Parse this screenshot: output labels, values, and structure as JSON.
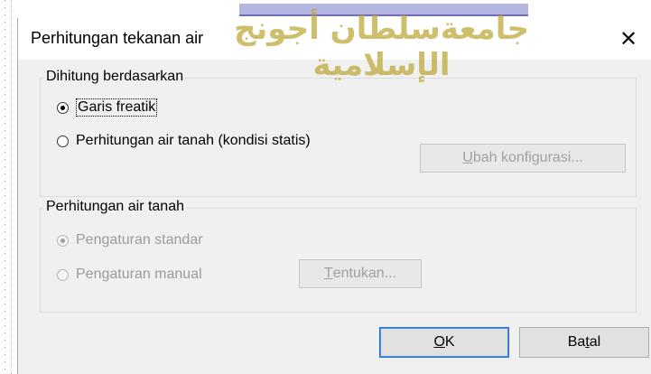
{
  "window": {
    "title": "Perhitungan tekanan air",
    "close_symbol": "✕"
  },
  "group_basis": {
    "legend": "Dihitung berdasarkan",
    "options": [
      {
        "label": "Garis freatik",
        "checked": true,
        "enabled": true
      },
      {
        "label": "Perhitungan air tanah (kondisi statis)",
        "checked": false,
        "enabled": true
      }
    ],
    "change_config_button": {
      "mnemonic": "U",
      "rest": "bah konfigurasi...",
      "enabled": false
    }
  },
  "group_groundwater": {
    "legend": "Perhitungan air tanah",
    "options": [
      {
        "label": "Pengaturan standar",
        "checked": true,
        "enabled": false
      },
      {
        "label": "Pengaturan manual",
        "checked": false,
        "enabled": false
      }
    ],
    "define_button": {
      "mnemonic": "T",
      "rest": "entukan...",
      "enabled": false
    }
  },
  "buttons": {
    "ok": {
      "mnemonic": "O",
      "rest": "K"
    },
    "cancel": {
      "pre": "Ba",
      "mnemonic": "t",
      "rest": "al"
    }
  },
  "watermark": {
    "text": "جامعةسلطان أجونج الإسلامية"
  }
}
